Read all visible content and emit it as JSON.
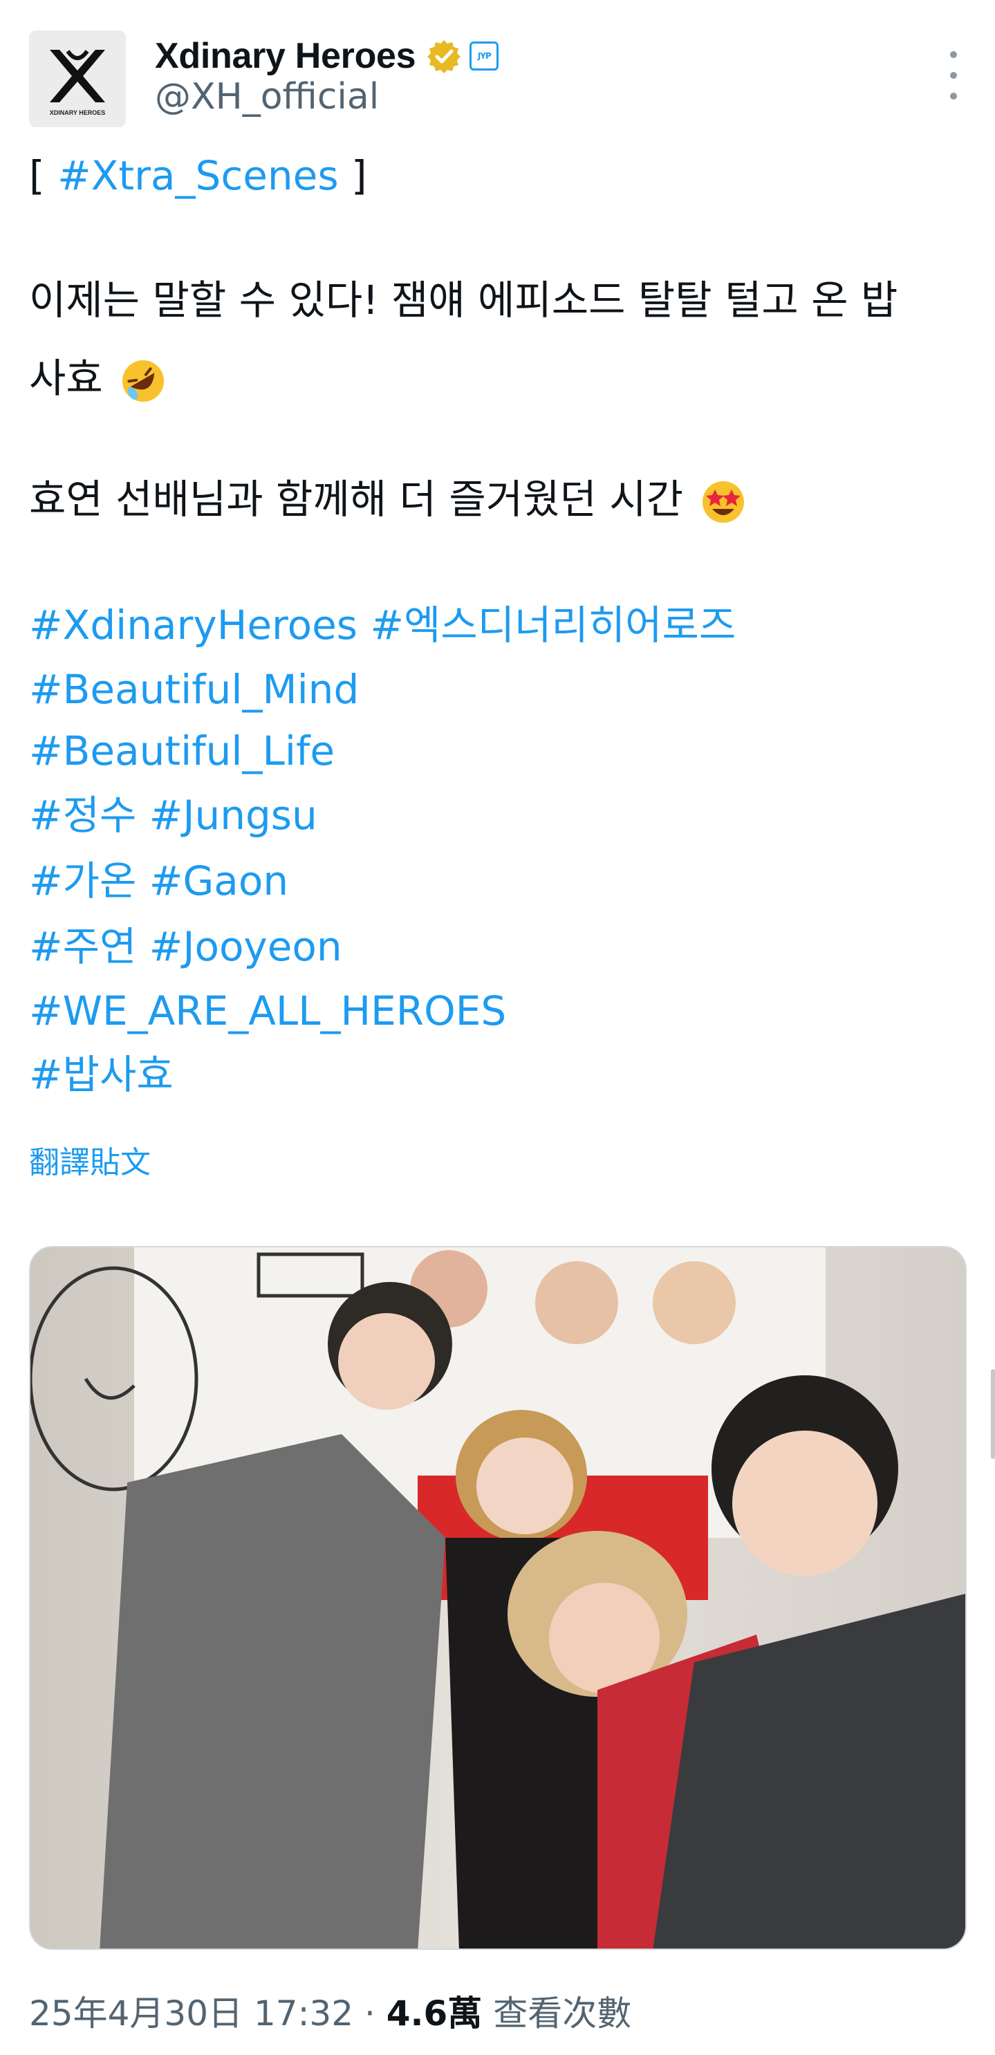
{
  "account": {
    "display_name": "Xdinary Heroes",
    "handle": "@XH_official",
    "avatar_text": "XDINARY HEROES",
    "affiliate_badge": "JYP"
  },
  "tweet": {
    "lines": [
      {
        "prefix": "[ ",
        "tag": "#Xtra_Scenes",
        "suffix": " ]"
      },
      {
        "text": "이제는 말할 수 있다! 잼얘 에피소드 탈탈 털고 온 밥"
      },
      {
        "text": "사효",
        "emoji": "rolling-on-floor-laughing"
      },
      {
        "text": "효연 선배님과 함께해 더 즐거웠던 시간",
        "emoji": "star-struck"
      }
    ],
    "hashtags": [
      "#XdinaryHeroes #엑스디너리히어로즈",
      "#Beautiful_Mind",
      "#Beautiful_Life",
      "#정수 #Jungsu",
      "#가온 #Gaon",
      "#주연 #Jooyeon",
      "#WE_ARE_ALL_HEROES",
      "#밥사효"
    ],
    "translate_label": "翻譯貼文"
  },
  "meta": {
    "timestamp": "25年4月30日 17:32",
    "separator": " · ",
    "views": "4.6萬",
    "views_label": " 查看次數"
  },
  "icons": {
    "verified": "verified-badge-icon",
    "more": "more-options-icon"
  },
  "colors": {
    "link": "#1d9bf0",
    "text": "#0f1419",
    "secondary": "#536471",
    "verified_gold": "#e8b923"
  }
}
